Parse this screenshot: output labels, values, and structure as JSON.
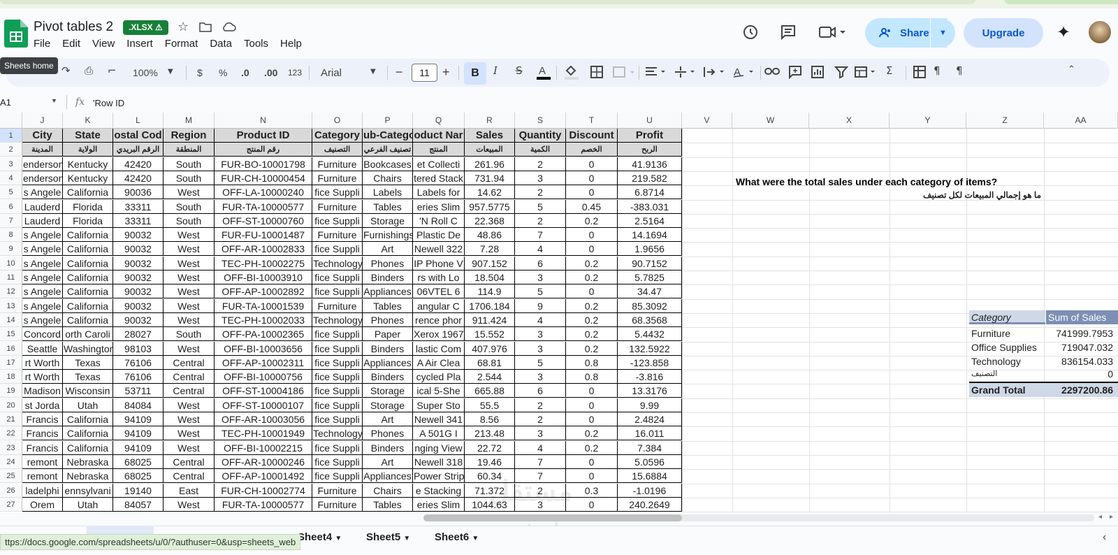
{
  "app": {
    "title": "Pivot tables 2",
    "badge": ".XLSX ⚠",
    "menu": [
      "File",
      "Edit",
      "View",
      "Insert",
      "Format",
      "Data",
      "Tools",
      "Help"
    ],
    "share_label": "Share",
    "upgrade_label": "Upgrade",
    "tooltip": "Sheets home"
  },
  "toolbar": {
    "zoom": "100%",
    "currency": "$",
    "percent": "%",
    "dec_decrease": ".0",
    "dec_increase": ".00",
    "format_123": "123",
    "font": "Arial",
    "font_size": "11",
    "minus": "−",
    "plus": "+"
  },
  "formula_bar": {
    "name_box": "A1",
    "formula": "'Row ID"
  },
  "columns": [
    "J",
    "K",
    "L",
    "M",
    "N",
    "O",
    "P",
    "Q",
    "R",
    "S",
    "T",
    "U",
    "V",
    "W",
    "X",
    "Y",
    "Z",
    "AA"
  ],
  "row_numbers": [
    "1",
    "2",
    "3",
    "4",
    "5",
    "6",
    "7",
    "8",
    "9",
    "10",
    "11",
    "12",
    "13",
    "14",
    "15",
    "16",
    "17",
    "18",
    "19",
    "20",
    "21",
    "22",
    "23",
    "24",
    "25",
    "26",
    "27"
  ],
  "headers_en": [
    "City",
    "State",
    "ostal Cod",
    "Region",
    "Product ID",
    "Category",
    "ub-Catego",
    "oduct Nar",
    "Sales",
    "Quantity",
    "Discount",
    "Profit"
  ],
  "headers_ar": [
    "المدينة",
    "الولاية",
    "الرقم البريدي",
    "المنطقة",
    "رقم المنتج",
    "التصنيف",
    "تصنيف الفرعي",
    "المنتج",
    "المبيعات",
    "الكمية",
    "الخصم",
    "الربح"
  ],
  "rows": [
    [
      "enderson",
      "Kentucky",
      "42420",
      "South",
      "FUR-BO-10001798",
      "Furniture",
      "Bookcases",
      "et Collecti",
      "261.96",
      "2",
      "0",
      "41.9136"
    ],
    [
      "enderson",
      "Kentucky",
      "42420",
      "South",
      "FUR-CH-10000454",
      "Furniture",
      "Chairs",
      "tered Stack",
      "731.94",
      "3",
      "0",
      "219.582"
    ],
    [
      "s Angele",
      "California",
      "90036",
      "West",
      "OFF-LA-10000240",
      "fice Suppli",
      "Labels",
      "Labels for",
      "14.62",
      "2",
      "0",
      "6.8714"
    ],
    [
      "Lauderd",
      "Florida",
      "33311",
      "South",
      "FUR-TA-10000577",
      "Furniture",
      "Tables",
      "eries Slim",
      "957.5775",
      "5",
      "0.45",
      "-383.031"
    ],
    [
      "Lauderd",
      "Florida",
      "33311",
      "South",
      "OFF-ST-10000760",
      "fice Suppli",
      "Storage",
      "'N Roll C",
      "22.368",
      "2",
      "0.2",
      "2.5164"
    ],
    [
      "s Angele",
      "California",
      "90032",
      "West",
      "FUR-FU-10001487",
      "Furniture",
      "Furnishings",
      "Plastic De",
      "48.86",
      "7",
      "0",
      "14.1694"
    ],
    [
      "s Angele",
      "California",
      "90032",
      "West",
      "OFF-AR-10002833",
      "fice Suppli",
      "Art",
      "Newell 322",
      "7.28",
      "4",
      "0",
      "1.9656"
    ],
    [
      "s Angele",
      "California",
      "90032",
      "West",
      "TEC-PH-10002275",
      "Technology",
      "Phones",
      "IP Phone V",
      "907.152",
      "6",
      "0.2",
      "90.7152"
    ],
    [
      "s Angele",
      "California",
      "90032",
      "West",
      "OFF-BI-10003910",
      "fice Suppli",
      "Binders",
      "rs with Lo",
      "18.504",
      "3",
      "0.2",
      "5.7825"
    ],
    [
      "s Angele",
      "California",
      "90032",
      "West",
      "OFF-AP-10002892",
      "fice Suppli",
      "Appliances",
      "06VTEL 6",
      "114.9",
      "5",
      "0",
      "34.47"
    ],
    [
      "s Angele",
      "California",
      "90032",
      "West",
      "FUR-TA-10001539",
      "Furniture",
      "Tables",
      "angular C",
      "1706.184",
      "9",
      "0.2",
      "85.3092"
    ],
    [
      "s Angele",
      "California",
      "90032",
      "West",
      "TEC-PH-10002033",
      "Technology",
      "Phones",
      "rence phor",
      "911.424",
      "4",
      "0.2",
      "68.3568"
    ],
    [
      "Concord",
      "orth Caroli",
      "28027",
      "South",
      "OFF-PA-10002365",
      "fice Suppli",
      "Paper",
      "Xerox 1967",
      "15.552",
      "3",
      "0.2",
      "5.4432"
    ],
    [
      "Seattle",
      "Washingtor",
      "98103",
      "West",
      "OFF-BI-10003656",
      "fice Suppli",
      "Binders",
      "lastic Com",
      "407.976",
      "3",
      "0.2",
      "132.5922"
    ],
    [
      "rt Worth",
      "Texas",
      "76106",
      "Central",
      "OFF-AP-10002311",
      "fice Suppli",
      "Appliances",
      "A Air Clea",
      "68.81",
      "5",
      "0.8",
      "-123.858"
    ],
    [
      "rt Worth",
      "Texas",
      "76106",
      "Central",
      "OFF-BI-10000756",
      "fice Suppli",
      "Binders",
      "cycled Pla",
      "2.544",
      "3",
      "0.8",
      "-3.816"
    ],
    [
      "Madison",
      "Wisconsin",
      "53711",
      "Central",
      "OFF-ST-10004186",
      "fice Suppli",
      "Storage",
      "ical 5-She",
      "665.88",
      "6",
      "0",
      "13.3176"
    ],
    [
      "st Jorda",
      "Utah",
      "84084",
      "West",
      "OFF-ST-10000107",
      "fice Suppli",
      "Storage",
      "Super Sto",
      "55.5",
      "2",
      "0",
      "9.99"
    ],
    [
      "Francis",
      "California",
      "94109",
      "West",
      "OFF-AR-10003056",
      "fice Suppli",
      "Art",
      "Newell 341",
      "8.56",
      "2",
      "0",
      "2.4824"
    ],
    [
      "Francis",
      "California",
      "94109",
      "West",
      "TEC-PH-10001949",
      "Technology",
      "Phones",
      "A 501G I",
      "213.48",
      "3",
      "0.2",
      "16.011"
    ],
    [
      "Francis",
      "California",
      "94109",
      "West",
      "OFF-BI-10002215",
      "fice Suppli",
      "Binders",
      "nging View",
      "22.72",
      "4",
      "0.2",
      "7.384"
    ],
    [
      "remont",
      "Nebraska",
      "68025",
      "Central",
      "OFF-AR-10000246",
      "fice Suppli",
      "Art",
      "Newell 318",
      "19.46",
      "7",
      "0",
      "5.0596"
    ],
    [
      "remont",
      "Nebraska",
      "68025",
      "Central",
      "OFF-AP-10001492",
      "fice Suppli",
      "Appliances",
      "Power Strip",
      "60.34",
      "7",
      "0",
      "15.6884"
    ],
    [
      "ladelphi",
      "ennsylvani",
      "19140",
      "East",
      "FUR-CH-10002774",
      "Furniture",
      "Chairs",
      "e Stacking",
      "71.372",
      "2",
      "0.3",
      "-1.0196"
    ],
    [
      "Orem",
      "Utah",
      "84057",
      "West",
      "FUR-TA-10000577",
      "Furniture",
      "Tables",
      "eries Slim",
      "1044.63",
      "3",
      "0",
      "240.2649"
    ]
  ],
  "question": {
    "en": "What were the total sales under each category of items?",
    "ar": "ما هو إجمالي المبيعات لكل تصنيف"
  },
  "pivot": {
    "header_category": "Category",
    "header_sum": "Sum of Sales",
    "rows": [
      {
        "label": "Furniture",
        "value": "741999.7953"
      },
      {
        "label": "Office Supplies",
        "value": "719047.032"
      },
      {
        "label": "Technology",
        "value": "836154.033"
      },
      {
        "label": "التصنيف",
        "value": "0"
      }
    ],
    "total_label": "Grand Total",
    "total_value": "2297200.86"
  },
  "tabs": [
    "Sheet4",
    "Sheet5",
    "Sheet6"
  ],
  "status_url": "ttps://docs.google.com/spreadsheets/u/0/?authuser=0&usp=sheets_web",
  "watermark": "mostaql.com",
  "watermark_ar": "مستقل"
}
